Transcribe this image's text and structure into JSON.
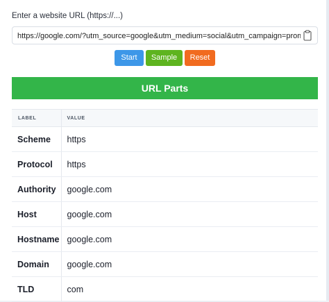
{
  "form": {
    "url_label": "Enter a website URL (https://...)",
    "url_value": "https://google.com/?utm_source=google&utm_medium=social&utm_campaign=promotion&utm_",
    "clipboard_icon": "clipboard-icon"
  },
  "buttons": {
    "start": "Start",
    "sample": "Sample",
    "reset": "Reset"
  },
  "colors": {
    "start": "#3d97e8",
    "sample": "#5eb41f",
    "reset": "#f16b1f",
    "section_header": "#33b549"
  },
  "section": {
    "title": "URL Parts"
  },
  "table": {
    "headers": {
      "label": "LABEL",
      "value": "VALUE"
    },
    "rows": [
      {
        "label": "Scheme",
        "value": "https"
      },
      {
        "label": "Protocol",
        "value": "https"
      },
      {
        "label": "Authority",
        "value": "google.com"
      },
      {
        "label": "Host",
        "value": "google.com"
      },
      {
        "label": "Hostname",
        "value": "google.com"
      },
      {
        "label": "Domain",
        "value": "google.com"
      },
      {
        "label": "TLD",
        "value": "com"
      }
    ]
  }
}
